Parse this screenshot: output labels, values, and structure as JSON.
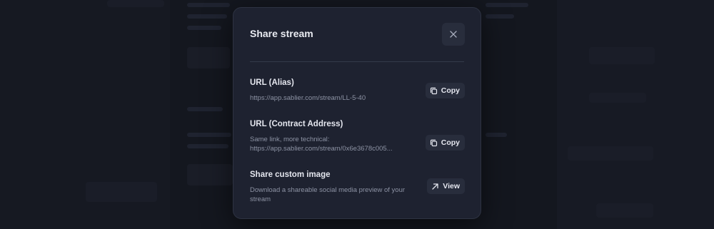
{
  "modal": {
    "title": "Share stream"
  },
  "rows": [
    {
      "title": "URL (Alias)",
      "description": "https://app.sablier.com/stream/LL-5-40",
      "action_label": "Copy",
      "action_icon": "copy-icon"
    },
    {
      "title": "URL (Contract Address)",
      "description_line1": "Same link, more technical:",
      "description_line2": "https://app.sablier.com/stream/0x6e3678c005...",
      "action_label": "Copy",
      "action_icon": "copy-icon"
    },
    {
      "title": "Share custom image",
      "description": "Download a shareable social media preview of your stream",
      "action_label": "View",
      "action_icon": "arrow-up-right-icon"
    }
  ],
  "colors": {
    "modal_background": "#1e2230",
    "button_background": "#282d3c",
    "title_text": "#e9ebf1",
    "muted_text": "#8d93a4"
  }
}
